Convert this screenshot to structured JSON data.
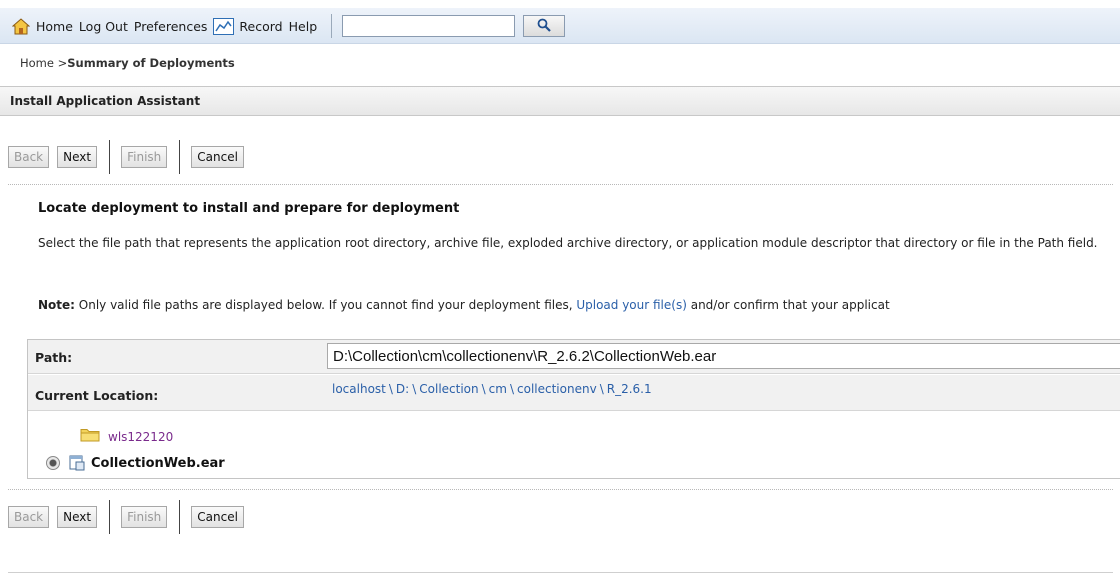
{
  "toolbar": {
    "home": "Home",
    "logout": "Log Out",
    "preferences": "Preferences",
    "record": "Record",
    "help": "Help",
    "search_value": "",
    "icons": {
      "home": "home-icon",
      "record": "record-icon",
      "search": "search-icon"
    }
  },
  "breadcrumb": {
    "root": "Home",
    "sep": " >",
    "current": "Summary of Deployments"
  },
  "assistant": {
    "title": "Install Application Assistant"
  },
  "buttons_top": {
    "back": "Back",
    "next": "Next",
    "finish": "Finish",
    "cancel": "Cancel"
  },
  "buttons_bottom": {
    "back": "Back",
    "next": "Next",
    "finish": "Finish",
    "cancel": "Cancel"
  },
  "section": {
    "title": "Locate deployment to install and prepare for deployment",
    "description": "Select the file path that represents the application root directory, archive file, exploded archive directory, or application module descriptor that directory or file in the Path field.",
    "note_label": "Note:",
    "note_text": " Only valid file paths are displayed below. If you cannot find your deployment files, ",
    "note_link": "Upload your file(s)",
    "note_tail": " and/or confirm that your applicat"
  },
  "path": {
    "label": "Path:",
    "value": "D:\\Collection\\cm\\collectionenv\\R_2.6.2\\CollectionWeb.ear"
  },
  "location": {
    "label": "Current Location:",
    "crumbs": [
      "localhost",
      "D:",
      "Collection",
      "cm",
      "collectionenv",
      "R_2.6.1"
    ],
    "separator": "\\"
  },
  "tree": {
    "folder": "wls122120",
    "file": "CollectionWeb.ear",
    "colors": {
      "folder": "#e8c44a",
      "visited_link": "#7a2b8c",
      "link": "#2a5fa8"
    }
  }
}
